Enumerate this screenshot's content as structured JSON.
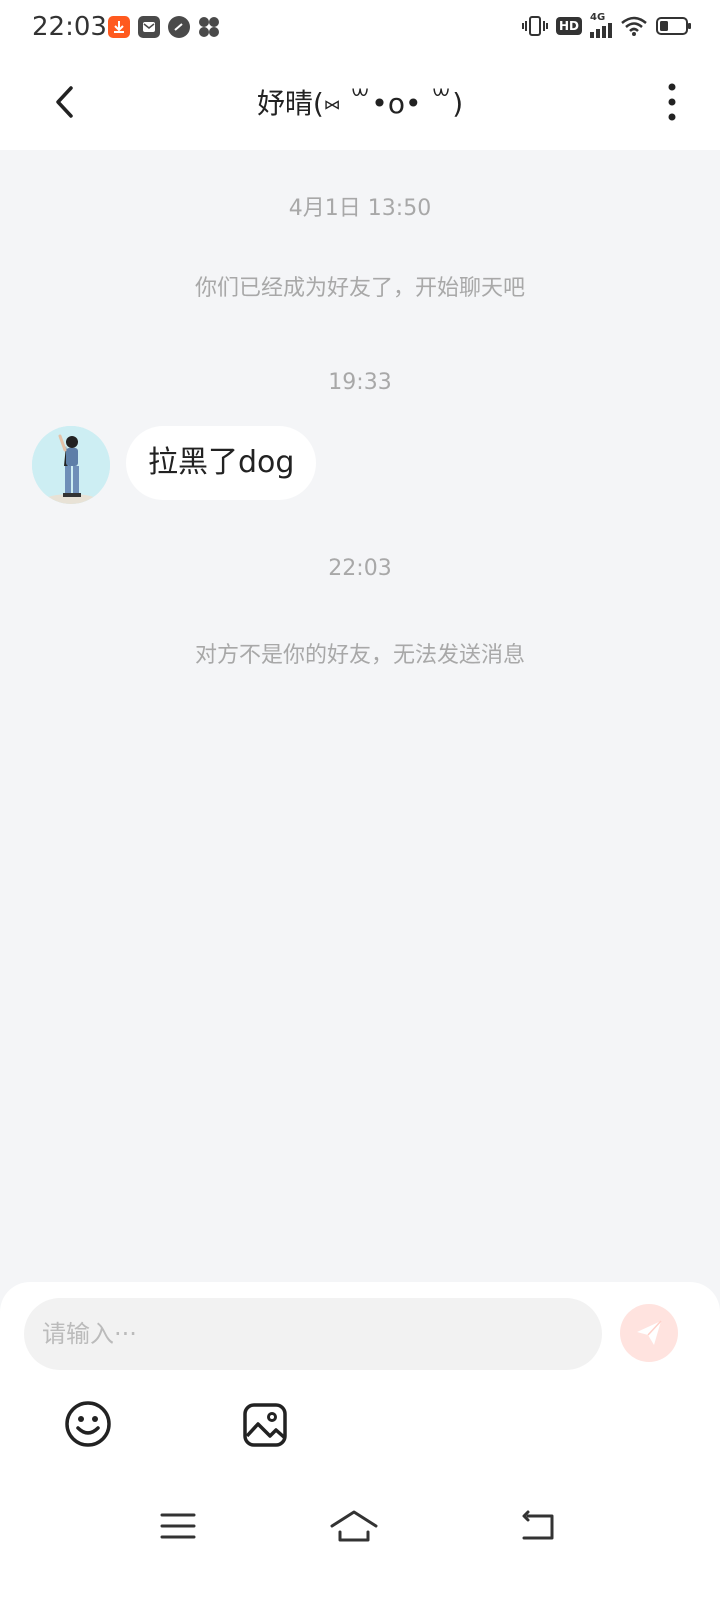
{
  "status_bar": {
    "time": "22:03",
    "notification_icons": [
      "download-icon",
      "mail-icon",
      "speed-icon",
      "fan-icon"
    ],
    "system_icons": [
      "vibrate-icon",
      "hd-icon",
      "4g-signal-icon",
      "wifi-icon",
      "battery-icon"
    ],
    "hd_label": "HD",
    "network_label": "4G"
  },
  "header": {
    "title": "妤晴(⑅ ꒳•o• ꒳)"
  },
  "chat": {
    "messages": [
      {
        "type": "time",
        "text": "4月1日  13:50"
      },
      {
        "type": "system",
        "text": "你们已经成为好友了，开始聊天吧"
      },
      {
        "type": "time",
        "text": "19:33"
      },
      {
        "type": "incoming",
        "text": "拉黑了dog"
      },
      {
        "type": "time",
        "text": "22:03"
      },
      {
        "type": "system",
        "text": "对方不是你的好友，无法发送消息"
      }
    ]
  },
  "composer": {
    "placeholder": "请输入···",
    "value": ""
  },
  "colors": {
    "background": "#f4f5f7",
    "send_button_disabled": "#ffe3df",
    "send_icon": "#ffffff",
    "muted_text": "#a8a8a8"
  }
}
